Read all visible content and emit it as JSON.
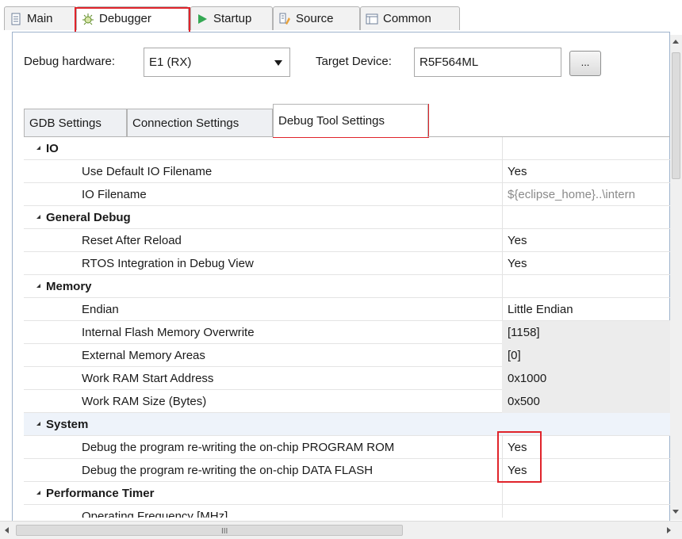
{
  "top_tabs": [
    {
      "label": "Main",
      "icon": "document-icon"
    },
    {
      "label": "Debugger",
      "icon": "bug-icon"
    },
    {
      "label": "Startup",
      "icon": "play-icon"
    },
    {
      "label": "Source",
      "icon": "source-icon"
    },
    {
      "label": "Common",
      "icon": "common-icon"
    }
  ],
  "hardware": {
    "debug_hardware_label": "Debug hardware:",
    "debug_hardware_value": "E1 (RX)",
    "target_device_label": "Target Device:",
    "target_device_value": "R5F564ML",
    "browse_label": "..."
  },
  "sub_tabs": [
    "GDB Settings",
    "Connection Settings",
    "Debug Tool Settings"
  ],
  "properties": [
    {
      "type": "group",
      "name": "IO"
    },
    {
      "type": "child",
      "name": "Use Default IO Filename",
      "value": "Yes"
    },
    {
      "type": "child",
      "name": "IO Filename",
      "value": "${eclipse_home}..\\intern"
    },
    {
      "type": "group",
      "name": "General Debug"
    },
    {
      "type": "child",
      "name": "Reset After Reload",
      "value": "Yes"
    },
    {
      "type": "child",
      "name": "RTOS Integration in Debug View",
      "value": "Yes"
    },
    {
      "type": "group",
      "name": "Memory"
    },
    {
      "type": "child",
      "name": "Endian",
      "value": "Little Endian"
    },
    {
      "type": "child",
      "name": "Internal Flash Memory Overwrite",
      "value": "[1158]"
    },
    {
      "type": "child",
      "name": "External Memory Areas",
      "value": "[0]"
    },
    {
      "type": "child",
      "name": "Work RAM Start Address",
      "value": "0x1000"
    },
    {
      "type": "child",
      "name": "Work RAM Size (Bytes)",
      "value": "0x500"
    },
    {
      "type": "group",
      "name": "System"
    },
    {
      "type": "child",
      "name": "Debug the program re-writing the on-chip PROGRAM ROM",
      "value": "Yes"
    },
    {
      "type": "child",
      "name": "Debug the program re-writing the on-chip DATA FLASH",
      "value": "Yes"
    },
    {
      "type": "group",
      "name": "Performance Timer"
    },
    {
      "type": "child",
      "name": "Operating Frequency [MHz]",
      "value": ""
    }
  ],
  "scrollbar_grip": "III",
  "colors": {
    "highlight": "#e0242b",
    "selection": "#eef3fa",
    "border": "#9fb3cc"
  }
}
